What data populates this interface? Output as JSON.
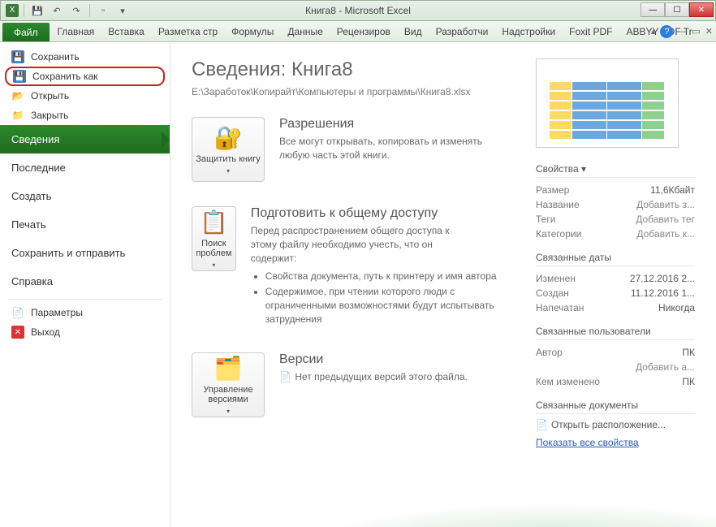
{
  "window": {
    "title": "Книга8 - Microsoft Excel",
    "app_icon": "X"
  },
  "ribbon": {
    "file": "Файл",
    "tabs": [
      "Главная",
      "Вставка",
      "Разметка стр",
      "Формулы",
      "Данные",
      "Рецензиров",
      "Вид",
      "Разработчи",
      "Надстройки",
      "Foxit PDF",
      "ABBYY PDF Tr"
    ]
  },
  "sidebar": {
    "save": "Сохранить",
    "save_as": "Сохранить как",
    "open": "Открыть",
    "close": "Закрыть",
    "info": "Сведения",
    "recent": "Последние",
    "new": "Создать",
    "print": "Печать",
    "save_send": "Сохранить и отправить",
    "help": "Справка",
    "options": "Параметры",
    "exit": "Выход"
  },
  "info": {
    "heading": "Сведения: Книга8",
    "path": "E:\\Заработок\\Копирайт\\Компьютеры и программы\\Книга8.xlsx",
    "permissions": {
      "title": "Разрешения",
      "desc": "Все могут открывать, копировать и изменять любую часть этой книги.",
      "button": "Защитить книгу"
    },
    "prepare": {
      "title": "Подготовить к общему доступу",
      "desc": "Перед распространением общего доступа к этому файлу необходимо учесть, что он содержит:",
      "bullets": [
        "Свойства документа, путь к принтеру и имя автора",
        "Содержимое, при чтении которого люди с ограниченными возможностями будут испытывать затруднения"
      ],
      "button": "Поиск проблем"
    },
    "versions": {
      "title": "Версии",
      "desc": "Нет предыдущих версий этого файла.",
      "button": "Управление версиями"
    }
  },
  "props": {
    "header": "Свойства",
    "size_k": "Размер",
    "size_v": "11,6Кбайт",
    "title_k": "Название",
    "title_v": "Добавить з...",
    "tags_k": "Теги",
    "tags_v": "Добавить тег",
    "cat_k": "Категории",
    "cat_v": "Добавить к...",
    "dates_header": "Связанные даты",
    "mod_k": "Изменен",
    "mod_v": "27.12.2016 2...",
    "created_k": "Создан",
    "created_v": "11.12.2016 1...",
    "printed_k": "Напечатан",
    "printed_v": "Никогда",
    "users_header": "Связанные пользователи",
    "author_k": "Автор",
    "author_v": "ПК",
    "add_author": "Добавить а...",
    "changed_k": "Кем изменено",
    "changed_v": "ПК",
    "docs_header": "Связанные документы",
    "open_location": "Открыть расположение...",
    "show_all": "Показать все свойства"
  }
}
